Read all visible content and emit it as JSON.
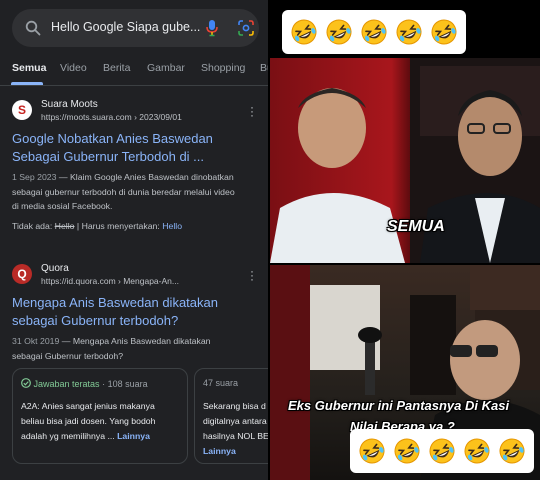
{
  "search": {
    "query": "Hello Google Siapa gube...",
    "tabs": [
      "Semua",
      "Video",
      "Berita",
      "Gambar",
      "Shopping",
      "Bu"
    ],
    "active_tab": "Semua"
  },
  "results": [
    {
      "site_name": "Suara Moots",
      "url": "https://moots.suara.com › 2023/09/01",
      "title_line1": "Google Nobatkan Anies Baswedan",
      "title_line2": "Sebagai Gubernur Terbodoh di ...",
      "date": "1 Sep 2023",
      "snippet_line1": " — Klaim Google Anies Baswedan dinobatkan",
      "snippet_line2": "sebagai gubernur terbodoh di dunia beredar melalui video",
      "snippet_line3": "di media sosial Facebook.",
      "missing_label": "Tidak ada:",
      "missing_word": "Hello",
      "must_include_label": "| Harus menyertakan:",
      "must_include_link": "Hello"
    },
    {
      "site_name": "Quora",
      "url": "https://id.quora.com › Mengapa-An...",
      "title_line1": "Mengapa Anis Baswedan dikatakan",
      "title_line2": "sebagai Gubernur terbodoh?",
      "date": "31 Okt 2019",
      "snippet_line1": " — Mengapa Anis Baswedan dikatakan",
      "snippet_line2": "sebagai Gubernur terbodoh?"
    }
  ],
  "answers": [
    {
      "badge": "Jawaban teratas",
      "votes": "· 108 suara",
      "line1": "A2A: Anies sangat jenius makanya",
      "line2": "beliau bisa jadi dosen. Yang bodoh",
      "line3": "adalah yg memilihnya ...",
      "more": "Lainnya"
    },
    {
      "votes": "47 suara",
      "line1": "Sekarang bisa d",
      "line2": "digitalnya antara",
      "line3": "hasilnya NOL BE",
      "more": "Lainnya"
    }
  ],
  "video": {
    "top_emoji_count": 5,
    "bottom_emoji_count": 5,
    "scene1_label": "SEMUA",
    "caption_line1": "Eks Gubernur ini Pantasnya Di Kasi",
    "caption_line2": "Nilai Berapa ya ?"
  },
  "colors": {
    "background": "#202124",
    "link": "#8ab4f8",
    "text": "#e8eaed",
    "muted": "#bdc1c6",
    "accent_green": "#81c995"
  },
  "icons": {
    "search": "search-icon",
    "mic": "mic-icon",
    "lens": "lens-icon",
    "more": "more-vert-icon",
    "check": "check-circle-icon",
    "laugh": "rolling-laughing-emoji"
  }
}
